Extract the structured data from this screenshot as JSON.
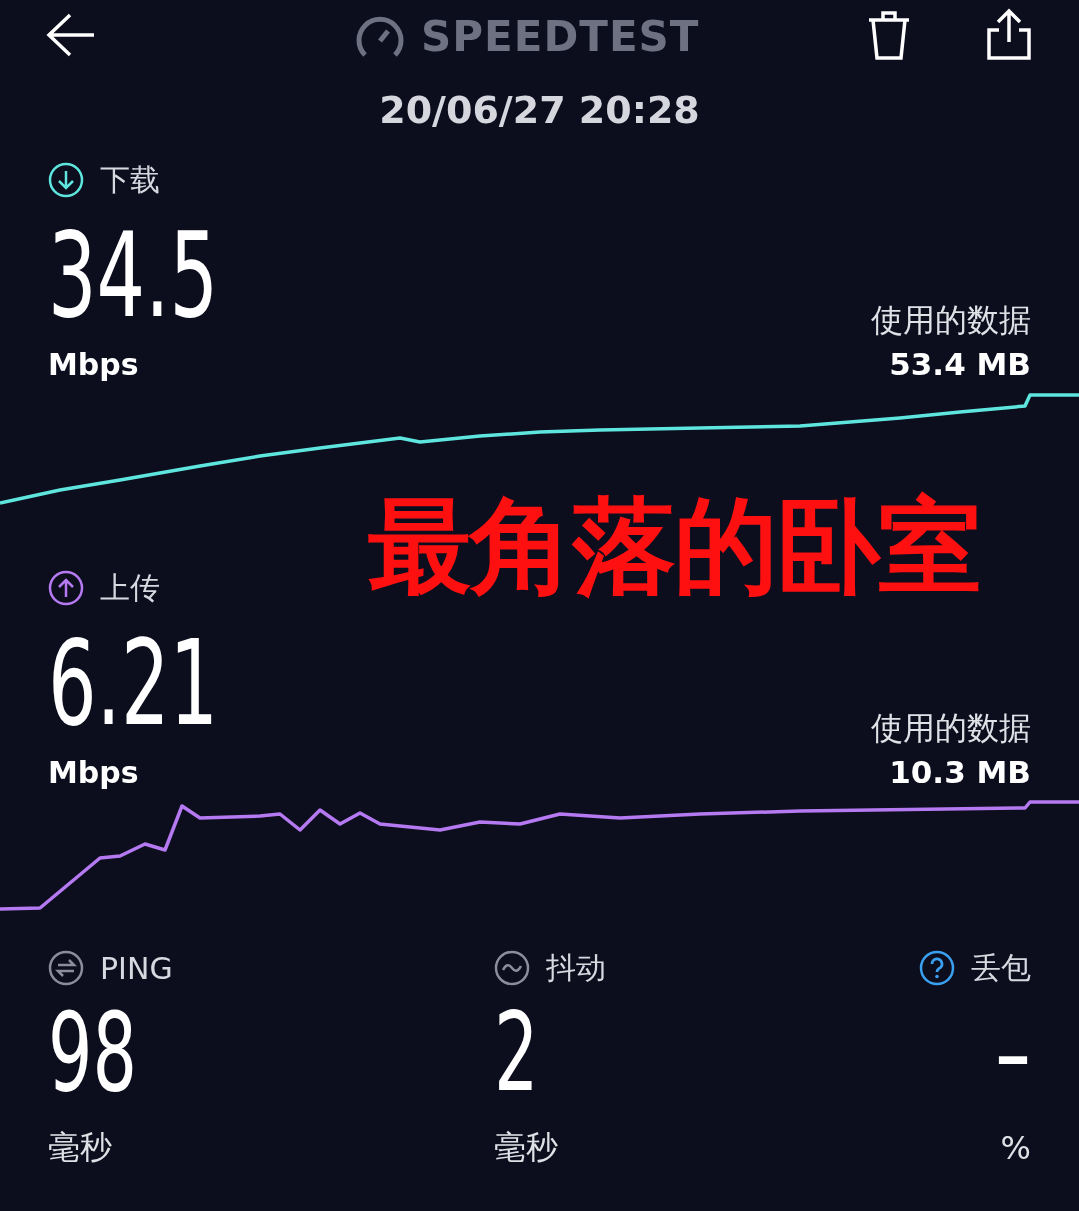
{
  "header": {
    "title": "SPEEDTEST",
    "date": "20/06/27 20:28"
  },
  "tests": [
    {
      "kind": "download",
      "label": "下载",
      "value": "34.5",
      "unit": "Mbps",
      "data_label": "使用的数据",
      "data_value": "53.4 MB",
      "color": "#5ee6de"
    },
    {
      "kind": "upload",
      "label": "上传",
      "value": "6.21",
      "unit": "Mbps",
      "data_label": "使用的数据",
      "data_value": "10.3 MB",
      "color": "#b57af2"
    }
  ],
  "stats": [
    {
      "kind": "ping",
      "label": "PING",
      "value": "98",
      "unit": "毫秒"
    },
    {
      "kind": "jitter",
      "label": "抖动",
      "value": "2",
      "unit": "毫秒"
    },
    {
      "kind": "loss",
      "label": "丢包",
      "value": "–",
      "unit": "%"
    }
  ],
  "annotation": "最角落的卧室"
}
